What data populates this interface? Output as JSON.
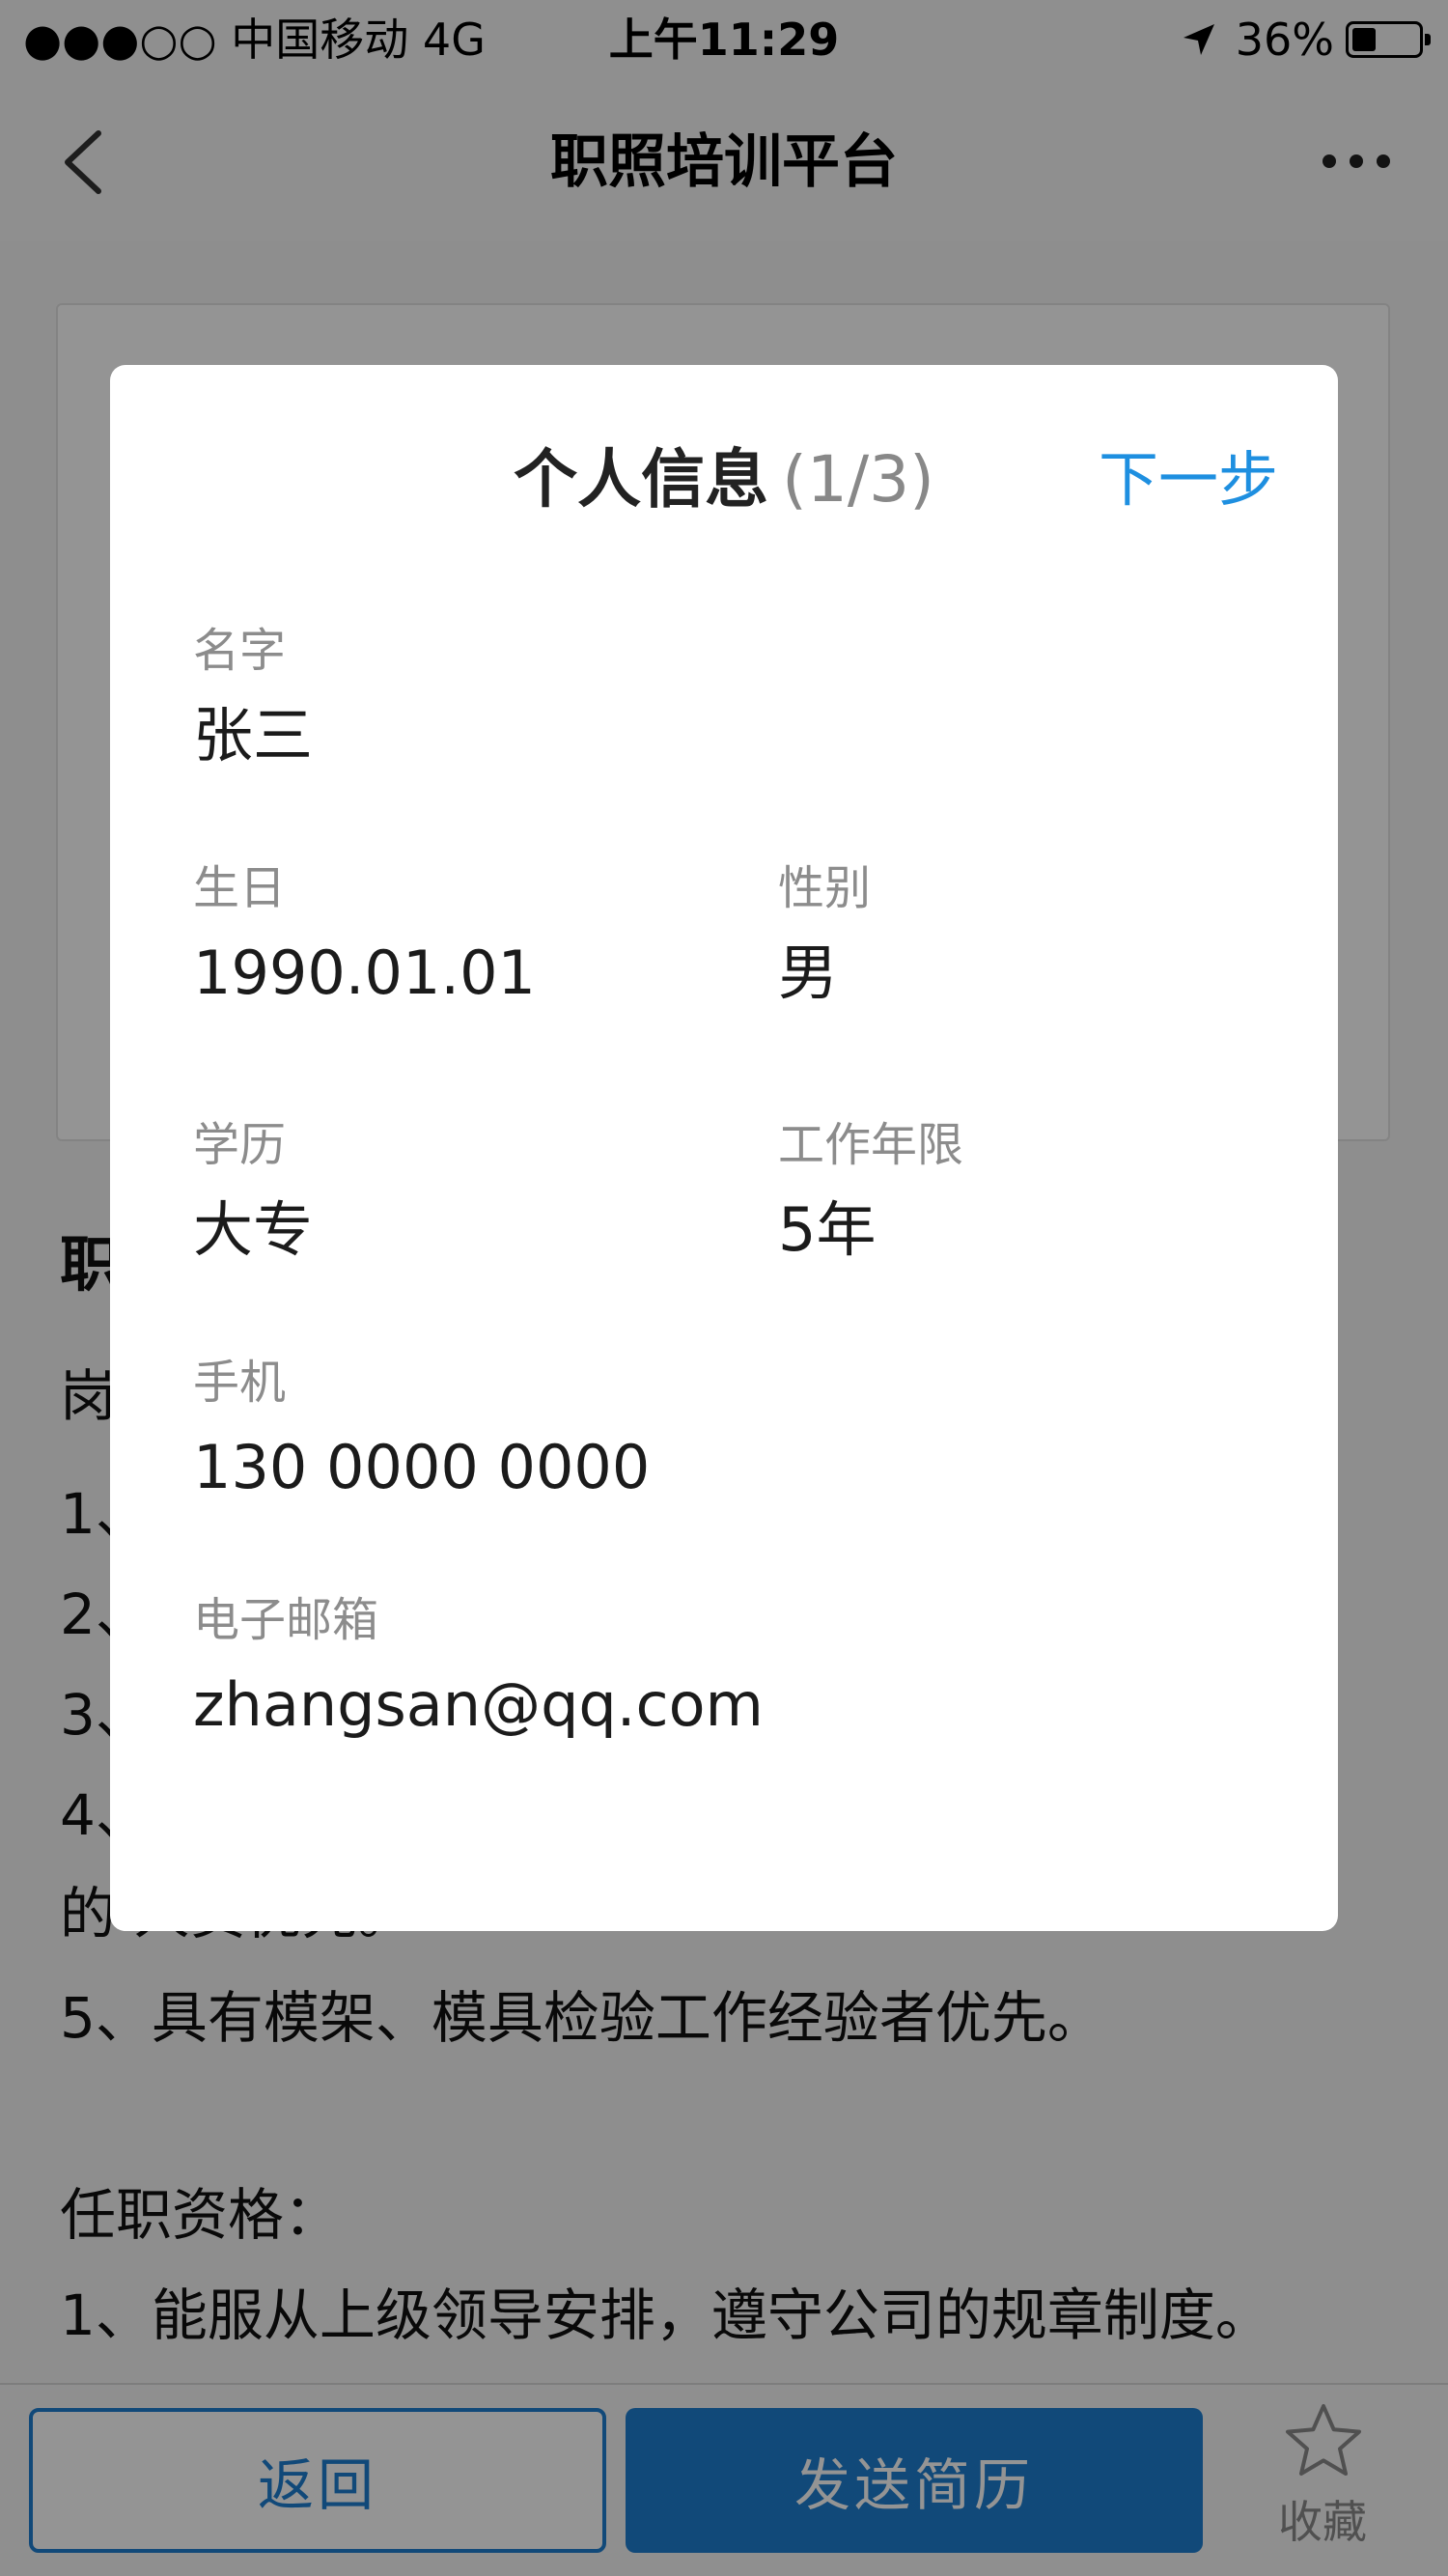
{
  "status_bar": {
    "carrier": "●●●○○ 中国移动   4G",
    "time": "上午11:29",
    "battery_percent": "36%",
    "battery_level": 0.36,
    "icons": [
      "location-arrow-icon",
      "battery-icon"
    ]
  },
  "nav": {
    "title": "职照培训平台",
    "back_icon": "chevron-left-icon",
    "more_icon": "more-dots-icon"
  },
  "background": {
    "heading": "职",
    "lines": [
      "岗",
      "1、",
      "2、",
      "3、",
      "4、                                                   职",
      "的 人员优先。",
      "5、具有模架、模具检验工作经验者优先。",
      "",
      "任职资格：",
      "1、能服从上级领导安排，遵守公司的规章制度。"
    ]
  },
  "modal": {
    "title": "个人信息",
    "step": "(1/3)",
    "next_label": "下一步",
    "fields": {
      "name": {
        "label": "名字",
        "value": "张三"
      },
      "birthday": {
        "label": "生日",
        "value": "1990.01.01"
      },
      "gender": {
        "label": "性别",
        "value": "男"
      },
      "education": {
        "label": "学历",
        "value": "大专"
      },
      "work_years": {
        "label": "工作年限",
        "value": "5年"
      },
      "phone": {
        "label": "手机",
        "value": "130 0000 0000"
      },
      "email": {
        "label": "电子邮箱",
        "value": "zhangsan@qq.com"
      }
    }
  },
  "toolbar": {
    "back_label": "返回",
    "send_label": "发送简历",
    "favorite_label": "收藏",
    "favorite_icon": "star-outline-icon"
  },
  "colors": {
    "accent": "#1e7fd0",
    "link": "#1e8fe0",
    "overlay": "rgba(0,0,0,0.42)"
  }
}
